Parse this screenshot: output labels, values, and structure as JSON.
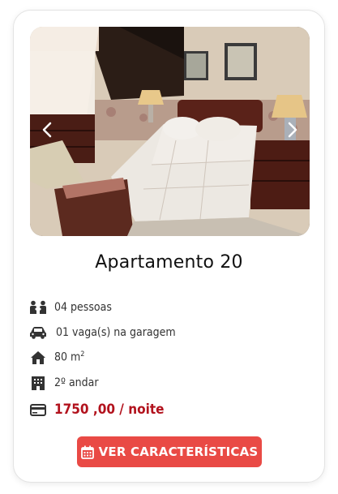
{
  "listing": {
    "title": "Apartamento 20",
    "features": {
      "guests": "04 pessoas",
      "parking": "01 vaga(s) na garagem",
      "area_value": "80 m",
      "area_sup": "2",
      "floor": "2º andar",
      "price": "1750 ,00 / noite"
    },
    "cta_label": "VER CARACTERÍSTICAS"
  },
  "icons": {
    "gallery_prev": "chevron-left-icon",
    "gallery_next": "chevron-right-icon",
    "guests": "people-icon",
    "parking": "car-icon",
    "area": "home-icon",
    "floor": "building-icon",
    "price": "credit-card-icon",
    "cta": "calendar-icon"
  },
  "colors": {
    "price": "#b2121d",
    "cta_background": "#e94a45",
    "icon": "#333333"
  }
}
